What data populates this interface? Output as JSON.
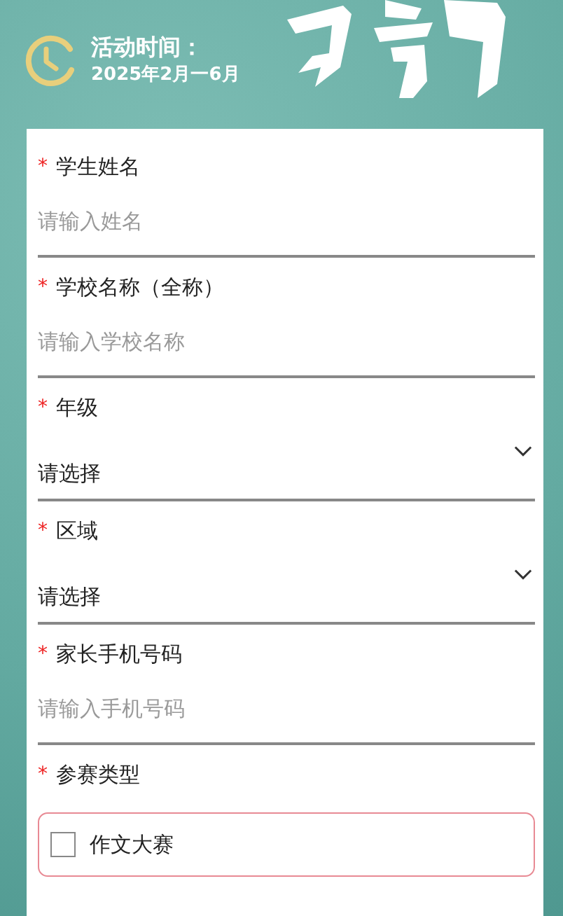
{
  "header": {
    "title": "活动时间：",
    "dates": "2025年2月一6月"
  },
  "form": {
    "fields": [
      {
        "kind": "text",
        "label": "学生姓名",
        "marker": "*",
        "placeholder": "请输入姓名"
      },
      {
        "kind": "text",
        "label": "学校名称（全称）",
        "marker": "*",
        "placeholder": "请输入学校名称"
      },
      {
        "kind": "select",
        "label": "年级",
        "marker": "*",
        "value": "请选择"
      },
      {
        "kind": "select",
        "label": "区域",
        "marker": "*",
        "value": "请选择"
      },
      {
        "kind": "text",
        "label": "家长手机号码",
        "marker": "*",
        "placeholder": "请输入手机号码"
      },
      {
        "kind": "checkboxes",
        "label": "参赛类型",
        "marker": "*",
        "options": [
          {
            "label": "作文大赛",
            "checked": false
          }
        ]
      }
    ]
  }
}
